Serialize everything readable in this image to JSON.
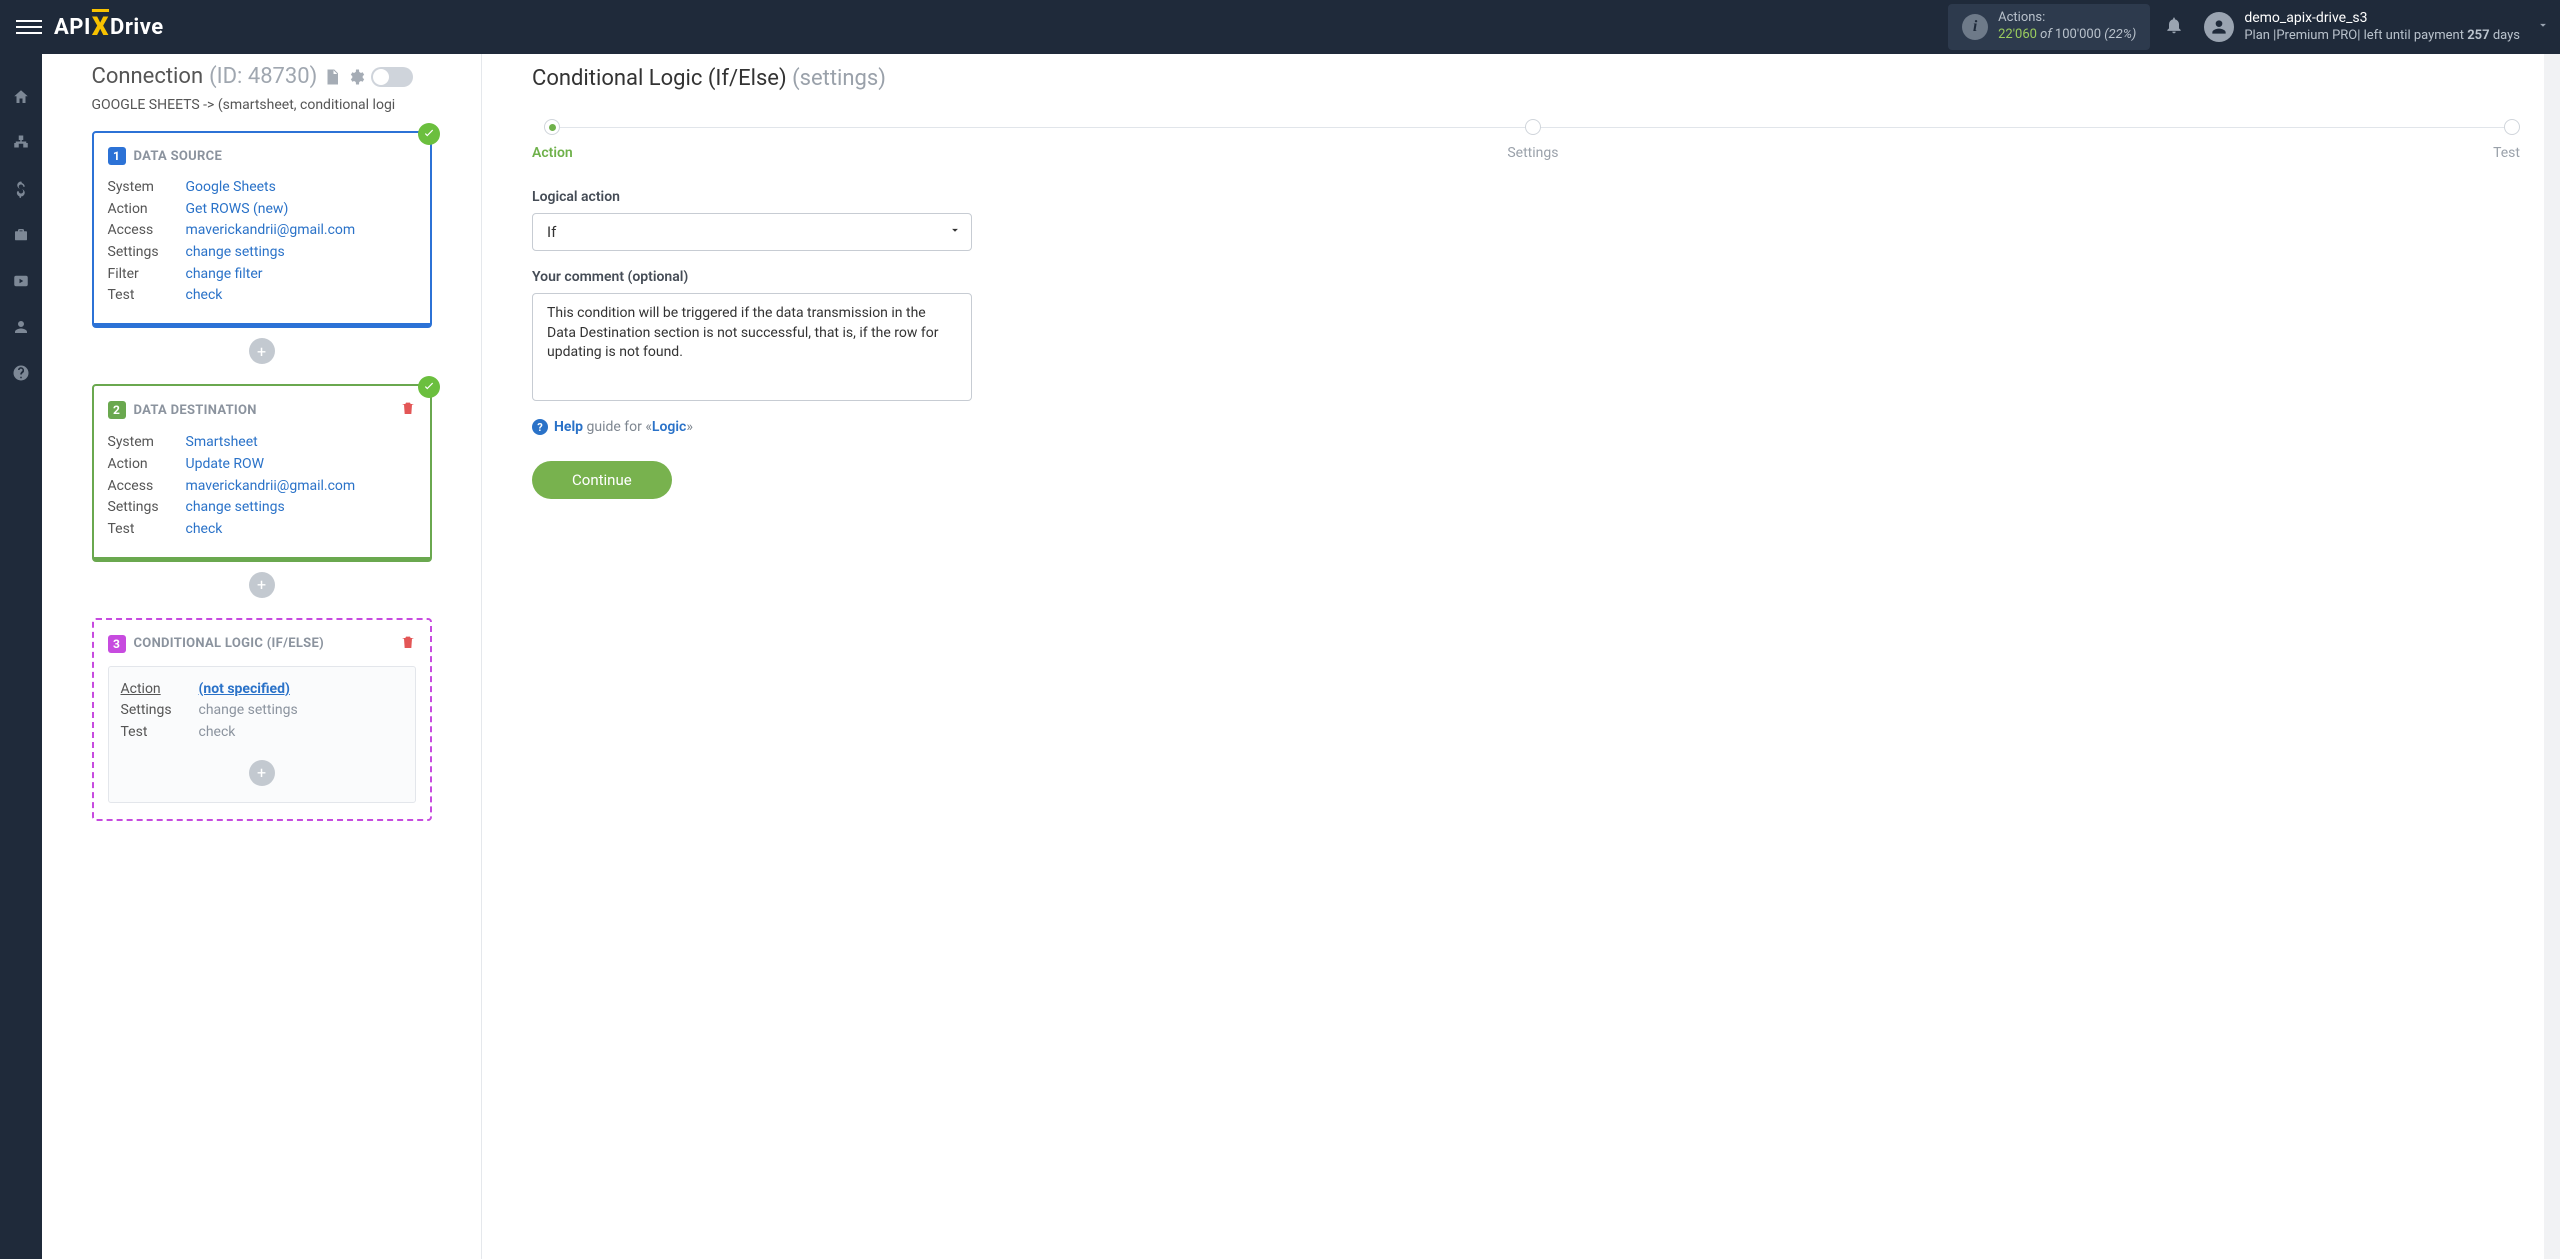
{
  "topbar": {
    "logo_prefix": "API",
    "logo_x": "X",
    "logo_suffix": "Drive",
    "actions_label": "Actions:",
    "actions_used": "22'060",
    "actions_of": " of ",
    "actions_total": "100'000",
    "actions_pct": " (22%)",
    "user_name": "demo_apix-drive_s3",
    "user_plan_prefix": "Plan |Premium PRO| left until payment ",
    "user_plan_days_num": "257",
    "user_plan_days_suffix": " days"
  },
  "leftrail": {
    "items": [
      {
        "name": "home-icon"
      },
      {
        "name": "sitemap-icon"
      },
      {
        "name": "dollar-icon"
      },
      {
        "name": "briefcase-icon"
      },
      {
        "name": "youtube-icon"
      },
      {
        "name": "user-icon"
      },
      {
        "name": "question-icon"
      }
    ]
  },
  "connection": {
    "title": "Connection",
    "id_text": "(ID: 48730)",
    "subtitle": "GOOGLE SHEETS -> (smartsheet, conditional logi"
  },
  "cards": {
    "source": {
      "title": "DATA SOURCE",
      "rows": {
        "system_k": "System",
        "system_v": "Google Sheets",
        "action_k": "Action",
        "action_v": "Get ROWS (new)",
        "access_k": "Access",
        "access_v": "maverickandrii@gmail.com",
        "settings_k": "Settings",
        "settings_v": "change settings",
        "filter_k": "Filter",
        "filter_v": "change filter",
        "test_k": "Test",
        "test_v": "check"
      }
    },
    "destination": {
      "title": "DATA DESTINATION",
      "rows": {
        "system_k": "System",
        "system_v": "Smartsheet",
        "action_k": "Action",
        "action_v": "Update ROW",
        "access_k": "Access",
        "access_v": "maverickandrii@gmail.com",
        "settings_k": "Settings",
        "settings_v": "change settings",
        "test_k": "Test",
        "test_v": "check"
      }
    },
    "logic": {
      "title": "CONDITIONAL LOGIC (IF/ELSE)",
      "rows": {
        "action_k": "Action",
        "action_v": "(not specified)",
        "settings_k": "Settings",
        "settings_v": "change settings",
        "test_k": "Test",
        "test_v": "check"
      }
    }
  },
  "main": {
    "title": "Conditional Logic (If/Else)",
    "title_paren": "(settings)",
    "steps": {
      "action": "Action",
      "settings": "Settings",
      "test": "Test"
    },
    "logical_action_label": "Logical action",
    "logical_action_value": "If",
    "comment_label": "Your comment (optional)",
    "comment_value": "This condition will be triggered if the data transmission in the Data Destination section is not successful, that is, if the row for updating is not found.",
    "help_bold": "Help",
    "help_grey": " guide for «",
    "help_link": "Logic",
    "help_close": "»",
    "continue": "Continue"
  }
}
